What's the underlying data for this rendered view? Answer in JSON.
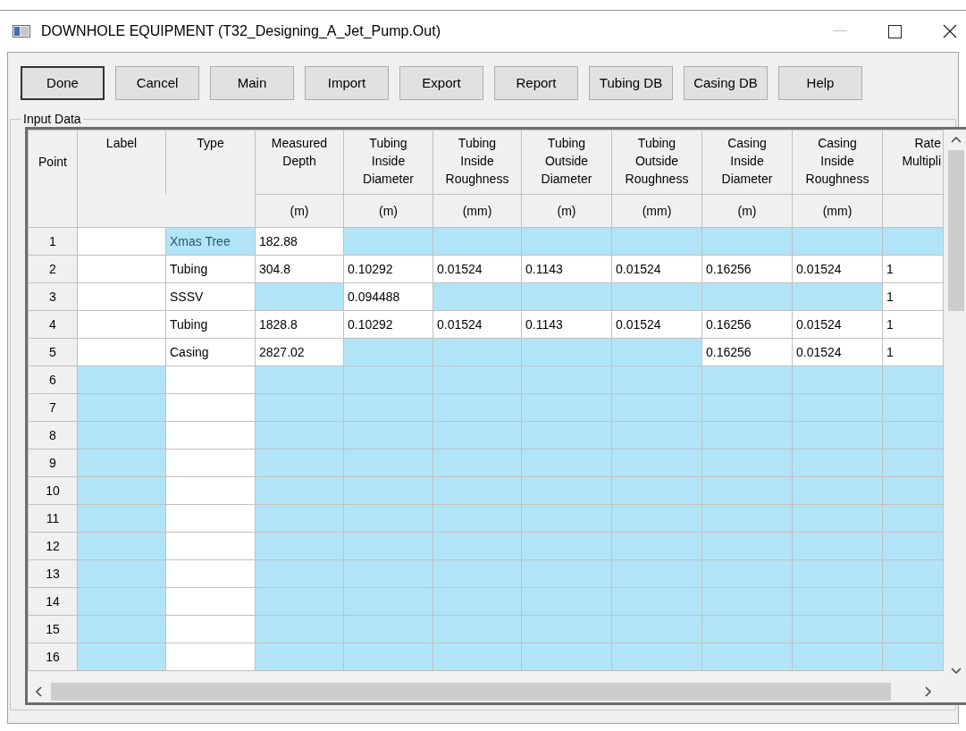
{
  "window": {
    "title": "DOWNHOLE EQUIPMENT (T32_Designing_A_Jet_Pump.Out)"
  },
  "buttons": [
    {
      "label": "Done",
      "default": true
    },
    {
      "label": "Cancel",
      "default": false
    },
    {
      "label": "Main",
      "default": false
    },
    {
      "label": "Import",
      "default": false
    },
    {
      "label": "Export",
      "default": false
    },
    {
      "label": "Report",
      "default": false
    },
    {
      "label": "Tubing DB",
      "default": false
    },
    {
      "label": "Casing DB",
      "default": false
    },
    {
      "label": "Help",
      "default": false
    }
  ],
  "group_title": "Input Data",
  "table": {
    "point_header": "Point",
    "columns": [
      {
        "header": "Label"
      },
      {
        "header": "Type"
      },
      {
        "header": "Measured\nDepth",
        "unit": "(m)"
      },
      {
        "header": "Tubing\nInside\nDiameter",
        "unit": "(m)"
      },
      {
        "header": "Tubing\nInside\nRoughness",
        "unit": "(mm)"
      },
      {
        "header": "Tubing\nOutside\nDiameter",
        "unit": "(m)"
      },
      {
        "header": "Tubing\nOutside\nRoughness",
        "unit": "(mm)"
      },
      {
        "header": "Casing\nInside\nDiameter",
        "unit": "(m)"
      },
      {
        "header": "Casing\nInside\nRoughness",
        "unit": "(mm)"
      },
      {
        "header": "Rate\nMultipli"
      }
    ],
    "rows": [
      {
        "point": "1",
        "cells": [
          {
            "shaded": false
          },
          {
            "value": "Xmas Tree",
            "shaded": true
          },
          {
            "value": "182.88",
            "shaded": false
          },
          {
            "shaded": true
          },
          {
            "shaded": true
          },
          {
            "shaded": true
          },
          {
            "shaded": true
          },
          {
            "shaded": true
          },
          {
            "shaded": true
          },
          {
            "shaded": true
          }
        ]
      },
      {
        "point": "2",
        "cells": [
          {
            "shaded": false
          },
          {
            "value": "Tubing",
            "shaded": false
          },
          {
            "value": "304.8",
            "shaded": false
          },
          {
            "value": "0.10292",
            "shaded": false
          },
          {
            "value": "0.01524",
            "shaded": false
          },
          {
            "value": "0.1143",
            "shaded": false
          },
          {
            "value": "0.01524",
            "shaded": false
          },
          {
            "value": "0.16256",
            "shaded": false
          },
          {
            "value": "0.01524",
            "shaded": false
          },
          {
            "value": "1",
            "shaded": false
          }
        ]
      },
      {
        "point": "3",
        "cells": [
          {
            "shaded": false
          },
          {
            "value": "SSSV",
            "shaded": false
          },
          {
            "shaded": true
          },
          {
            "value": "0.094488",
            "shaded": false
          },
          {
            "shaded": true
          },
          {
            "shaded": true
          },
          {
            "shaded": true
          },
          {
            "shaded": true
          },
          {
            "shaded": true
          },
          {
            "value": "1",
            "shaded": false
          }
        ]
      },
      {
        "point": "4",
        "cells": [
          {
            "shaded": false
          },
          {
            "value": "Tubing",
            "shaded": false
          },
          {
            "value": "1828.8",
            "shaded": false
          },
          {
            "value": "0.10292",
            "shaded": false
          },
          {
            "value": "0.01524",
            "shaded": false
          },
          {
            "value": "0.1143",
            "shaded": false
          },
          {
            "value": "0.01524",
            "shaded": false
          },
          {
            "value": "0.16256",
            "shaded": false
          },
          {
            "value": "0.01524",
            "shaded": false
          },
          {
            "value": "1",
            "shaded": false
          }
        ]
      },
      {
        "point": "5",
        "cells": [
          {
            "shaded": false
          },
          {
            "value": "Casing",
            "shaded": false
          },
          {
            "value": "2827.02",
            "shaded": false
          },
          {
            "shaded": true
          },
          {
            "shaded": true
          },
          {
            "shaded": true
          },
          {
            "shaded": true
          },
          {
            "value": "0.16256",
            "shaded": false
          },
          {
            "value": "0.01524",
            "shaded": false
          },
          {
            "value": "1",
            "shaded": false
          }
        ]
      },
      {
        "point": "6",
        "cells": [
          {
            "shaded": true
          },
          {
            "shaded": false
          },
          {
            "shaded": true
          },
          {
            "shaded": true
          },
          {
            "shaded": true
          },
          {
            "shaded": true
          },
          {
            "shaded": true
          },
          {
            "shaded": true
          },
          {
            "shaded": true
          },
          {
            "shaded": true
          }
        ]
      },
      {
        "point": "7",
        "cells": [
          {
            "shaded": true
          },
          {
            "shaded": false
          },
          {
            "shaded": true
          },
          {
            "shaded": true
          },
          {
            "shaded": true
          },
          {
            "shaded": true
          },
          {
            "shaded": true
          },
          {
            "shaded": true
          },
          {
            "shaded": true
          },
          {
            "shaded": true
          }
        ]
      },
      {
        "point": "8",
        "cells": [
          {
            "shaded": true
          },
          {
            "shaded": false
          },
          {
            "shaded": true
          },
          {
            "shaded": true
          },
          {
            "shaded": true
          },
          {
            "shaded": true
          },
          {
            "shaded": true
          },
          {
            "shaded": true
          },
          {
            "shaded": true
          },
          {
            "shaded": true
          }
        ]
      },
      {
        "point": "9",
        "cells": [
          {
            "shaded": true
          },
          {
            "shaded": false
          },
          {
            "shaded": true
          },
          {
            "shaded": true
          },
          {
            "shaded": true
          },
          {
            "shaded": true
          },
          {
            "shaded": true
          },
          {
            "shaded": true
          },
          {
            "shaded": true
          },
          {
            "shaded": true
          }
        ]
      },
      {
        "point": "10",
        "cells": [
          {
            "shaded": true
          },
          {
            "shaded": false
          },
          {
            "shaded": true
          },
          {
            "shaded": true
          },
          {
            "shaded": true
          },
          {
            "shaded": true
          },
          {
            "shaded": true
          },
          {
            "shaded": true
          },
          {
            "shaded": true
          },
          {
            "shaded": true
          }
        ]
      },
      {
        "point": "11",
        "cells": [
          {
            "shaded": true
          },
          {
            "shaded": false
          },
          {
            "shaded": true
          },
          {
            "shaded": true
          },
          {
            "shaded": true
          },
          {
            "shaded": true
          },
          {
            "shaded": true
          },
          {
            "shaded": true
          },
          {
            "shaded": true
          },
          {
            "shaded": true
          }
        ]
      },
      {
        "point": "12",
        "cells": [
          {
            "shaded": true
          },
          {
            "shaded": false
          },
          {
            "shaded": true
          },
          {
            "shaded": true
          },
          {
            "shaded": true
          },
          {
            "shaded": true
          },
          {
            "shaded": true
          },
          {
            "shaded": true
          },
          {
            "shaded": true
          },
          {
            "shaded": true
          }
        ]
      },
      {
        "point": "13",
        "cells": [
          {
            "shaded": true
          },
          {
            "shaded": false
          },
          {
            "shaded": true
          },
          {
            "shaded": true
          },
          {
            "shaded": true
          },
          {
            "shaded": true
          },
          {
            "shaded": true
          },
          {
            "shaded": true
          },
          {
            "shaded": true
          },
          {
            "shaded": true
          }
        ]
      },
      {
        "point": "14",
        "cells": [
          {
            "shaded": true
          },
          {
            "shaded": false
          },
          {
            "shaded": true
          },
          {
            "shaded": true
          },
          {
            "shaded": true
          },
          {
            "shaded": true
          },
          {
            "shaded": true
          },
          {
            "shaded": true
          },
          {
            "shaded": true
          },
          {
            "shaded": true
          }
        ]
      },
      {
        "point": "15",
        "cells": [
          {
            "shaded": true
          },
          {
            "shaded": false
          },
          {
            "shaded": true
          },
          {
            "shaded": true
          },
          {
            "shaded": true
          },
          {
            "shaded": true
          },
          {
            "shaded": true
          },
          {
            "shaded": true
          },
          {
            "shaded": true
          },
          {
            "shaded": true
          }
        ]
      },
      {
        "point": "16",
        "cells": [
          {
            "shaded": true
          },
          {
            "shaded": false
          },
          {
            "shaded": true
          },
          {
            "shaded": true
          },
          {
            "shaded": true
          },
          {
            "shaded": true
          },
          {
            "shaded": true
          },
          {
            "shaded": true
          },
          {
            "shaded": true
          },
          {
            "shaded": true
          }
        ]
      }
    ]
  }
}
